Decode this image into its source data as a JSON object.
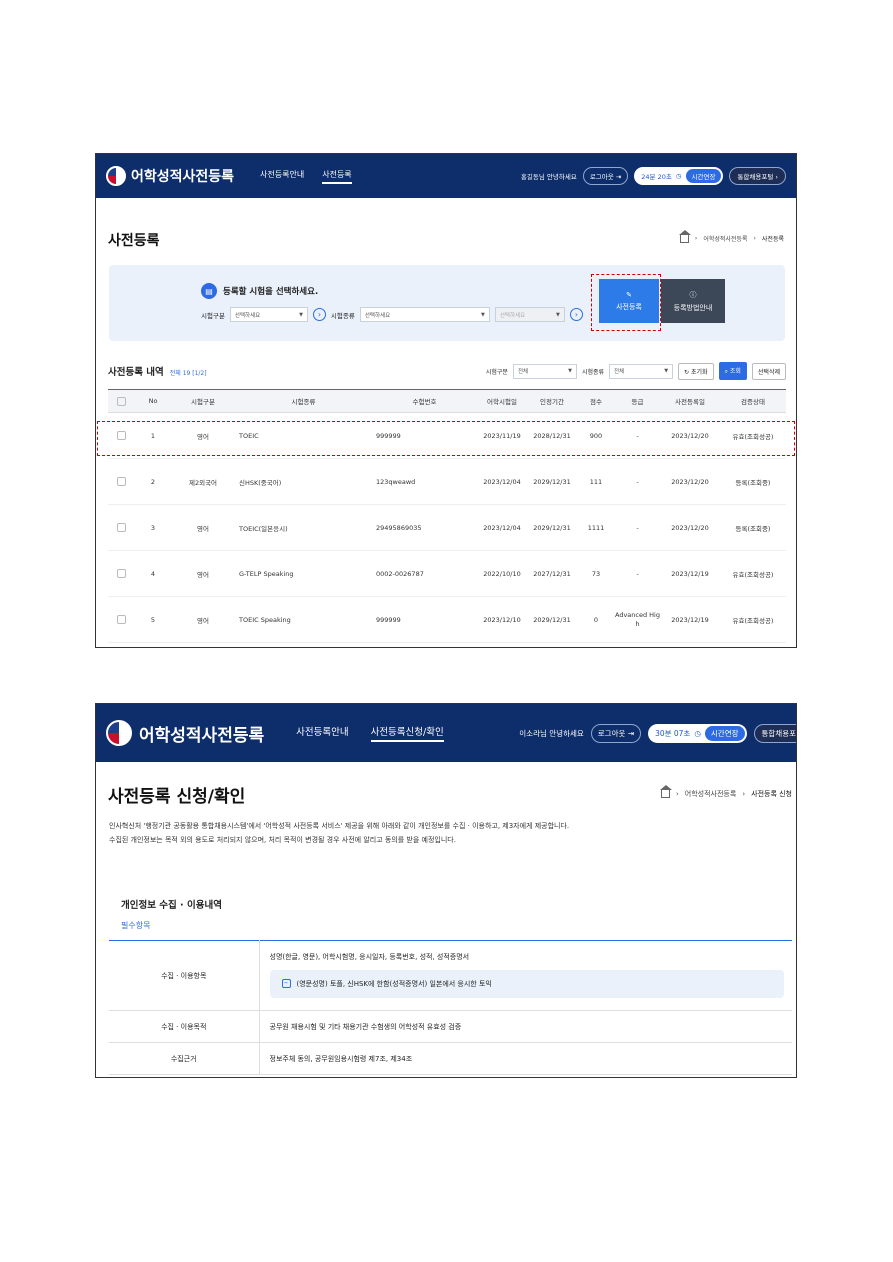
{
  "s1": {
    "logo": "어학성적사전등록",
    "nav": [
      "사전등록안내",
      "사전등록"
    ],
    "greeting": "홍길동님 안녕하세요",
    "logout": "로그아웃",
    "timer": "24분 20초",
    "extend": "시간연장",
    "portal": "통합채용포털",
    "title": "사전등록",
    "crumb": [
      "어학성적사전등록",
      "사전등록"
    ],
    "panel_heading": "등록할 시험을 선택하세요.",
    "exam_cat_label": "시험구분",
    "exam_type_label": "시험종류",
    "select_placeholder": "선택하세요",
    "btn_register": "사전등록",
    "btn_guide": "등록방법안내",
    "list_title": "사전등록 내역",
    "list_count": "전체 19 [1/2]",
    "filter_cat_label": "시험구분",
    "filter_type_label": "시험종류",
    "filter_all": "전체",
    "btn_reset": "초기화",
    "btn_search": "조회",
    "btn_delete": "선택삭제",
    "columns": [
      "No",
      "시험구분",
      "시험종류",
      "수험번호",
      "어학시험일",
      "인정기간",
      "점수",
      "등급",
      "사전등록일",
      "검증상태"
    ],
    "rows": [
      [
        "1",
        "영어",
        "TOEIC",
        "999999",
        "2023/11/19",
        "2028/12/31",
        "900",
        "-",
        "2023/12/20",
        "유효(조회성공)"
      ],
      [
        "2",
        "제2외국어",
        "신HSK(중국어)",
        "123qweawd",
        "2023/12/04",
        "2029/12/31",
        "111",
        "-",
        "2023/12/20",
        "등록(조회중)"
      ],
      [
        "3",
        "영어",
        "TOEIC(일본응시)",
        "29495869035",
        "2023/12/04",
        "2029/12/31",
        "1111",
        "-",
        "2023/12/20",
        "등록(조회중)"
      ],
      [
        "4",
        "영어",
        "G-TELP Speaking",
        "0002-0026787",
        "2022/10/10",
        "2027/12/31",
        "73",
        "-",
        "2023/12/19",
        "유효(조회성공)"
      ],
      [
        "5",
        "영어",
        "TOEIC Speaking",
        "999999",
        "2023/12/10",
        "2029/12/31",
        "0",
        "Advanced High",
        "2023/12/19",
        "유효(조회성공)"
      ]
    ]
  },
  "s2": {
    "logo": "어학성적사전등록",
    "nav": [
      "사전등록안내",
      "사전등록신청/확인"
    ],
    "greeting": "이소라님 안녕하세요",
    "logout": "로그아웃",
    "timer": "30분 07초",
    "extend": "시간연장",
    "portal": "통합채용포",
    "title": "사전등록 신청/확인",
    "crumb": [
      "어학성적사전등록",
      "사전등록 신청"
    ],
    "notice1": "인사혁신처 '행정기관 공동활용 통합채용시스템'에서 '어학성적 사전등록 서비스' 제공을 위해 아래와 같이 개인정보를 수집 · 이용하고, 제3자에게 제공합니다.",
    "notice2": "수집된 개인정보는 목적 외의 용도로 처리되지 않으며, 처리 목적이 변경될 경우 사전에 알리고 동의를 받을 예정입니다.",
    "section": "개인정보 수집 · 이용내역",
    "required": "필수항목",
    "rows": [
      {
        "k": "수집 · 이용항목",
        "v": "성명(한글, 영문), 어학시험명, 응시일자, 등록번호, 성적, 성적증명서",
        "sub": "(영문성명) 토플, 신HSK에 한함(성적증명서) 일본에서 응시한 토익"
      },
      {
        "k": "수집 · 이용목적",
        "v": "공무원 채용시험 및 기타 채용기관 수험생의 어학성적 유효성 검증"
      },
      {
        "k": "수집근거",
        "v": "정보주체 동의, 공무원임용시험령 제7조, 제34조"
      }
    ]
  },
  "icons": [
    "home-icon",
    "logout-icon",
    "clock-icon",
    "pencil-icon",
    "info-icon",
    "refresh-icon",
    "search-icon",
    "arrow-circle-icon",
    "minus-box-icon"
  ]
}
